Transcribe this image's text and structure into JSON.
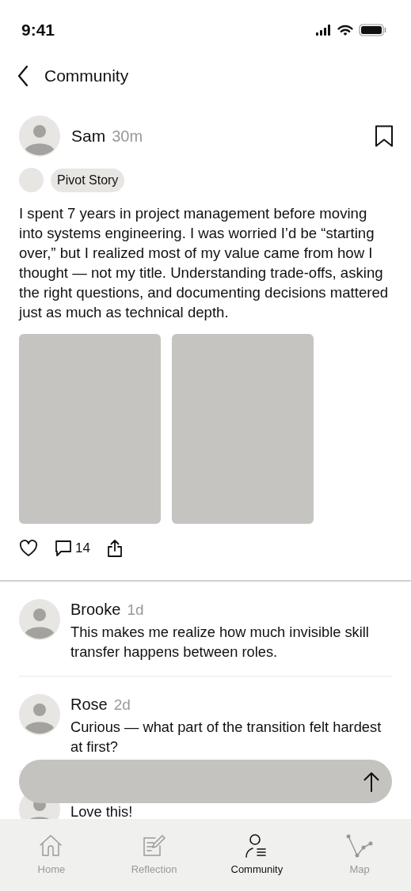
{
  "status_bar": {
    "time": "9:41"
  },
  "header": {
    "title": "Community"
  },
  "post": {
    "author": "Sam",
    "time": "30m",
    "saved": false,
    "tag": "Pivot Story",
    "body": "I spent 7 years in project management before moving into systems engineering. I was worried I’d be “starting over,” but I realized most of my value came from how I thought — not my title. Understanding trade-offs, asking the right questions, and documenting decisions mattered just as much as technical depth.",
    "images": [
      {
        "kind": "placeholder"
      },
      {
        "kind": "placeholder"
      }
    ],
    "liked": false,
    "comment_count": "14"
  },
  "comments": [
    {
      "author": "Brooke",
      "time": "1d",
      "text": "This makes me realize how much invisible skill transfer happens between roles."
    },
    {
      "author": "Rose",
      "time": "2d",
      "text": "Curious — what part of the transition felt hardest at first?"
    },
    {
      "text": "Love this!"
    }
  ],
  "tabs": [
    {
      "label": "Home",
      "kind": "home",
      "selected": false
    },
    {
      "label": "Reflection",
      "kind": "reflection",
      "selected": false
    },
    {
      "label": "Community",
      "kind": "community",
      "selected": true
    },
    {
      "label": "Map",
      "kind": "map",
      "selected": false
    }
  ]
}
